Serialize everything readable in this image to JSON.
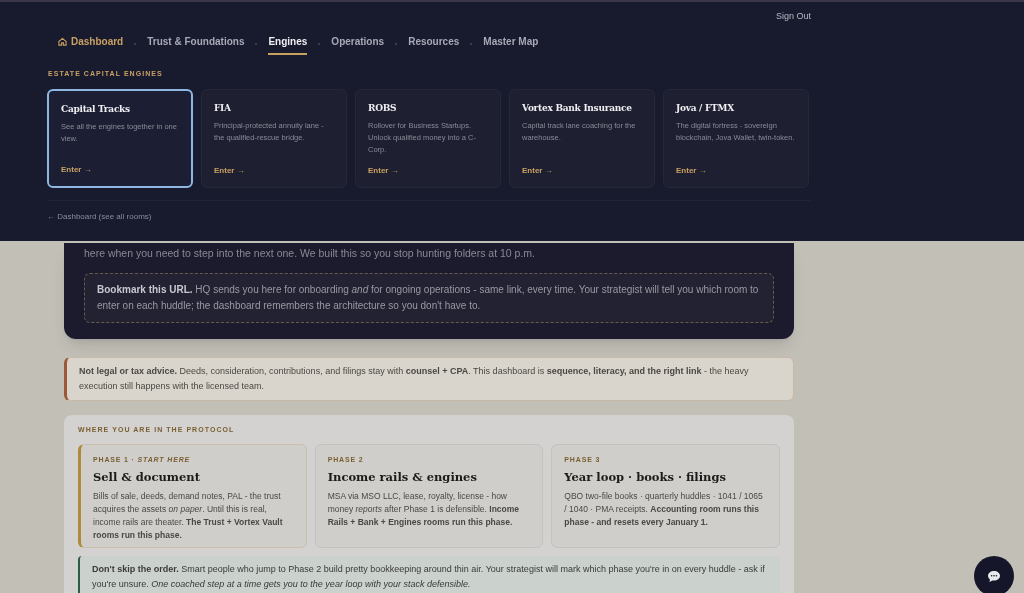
{
  "header": {
    "sign_out": "Sign Out",
    "nav": [
      {
        "label": "Dashboard",
        "kind": "home",
        "selected": false
      },
      {
        "label": "Trust & Foundations",
        "kind": "link",
        "selected": false
      },
      {
        "label": "Engines",
        "kind": "link",
        "selected": true
      },
      {
        "label": "Operations",
        "kind": "link",
        "selected": false
      },
      {
        "label": "Resources",
        "kind": "link",
        "selected": false
      },
      {
        "label": "Master Map",
        "kind": "link",
        "selected": false
      }
    ],
    "dropdown": {
      "heading": "ESTATE CAPITAL ENGINES",
      "engines": [
        {
          "title": "Capital Tracks",
          "description": "See all the engines together in one view.",
          "action": "Enter →",
          "selected": true
        },
        {
          "title": "FIA",
          "description": "Principal-protected annuity lane - the qualified-rescue bridge.",
          "action": "Enter →",
          "selected": false
        },
        {
          "title": "ROBS",
          "description": "Rollover for Business Startups. Unlock qualified money into a C-Corp.",
          "action": "Enter →",
          "selected": false
        },
        {
          "title": "Vortex Bank Insurance",
          "description": "Capital track lane coaching for the warehouse.",
          "action": "Enter →",
          "selected": false
        },
        {
          "title": "Jova / FTMX",
          "description": "The digital fortress - sovereign blockchain, Jova Wallet, twin-token.",
          "action": "Enter →",
          "selected": false
        }
      ],
      "back_link": "← Dashboard (see all rooms)"
    }
  },
  "hero": {
    "text": "here when you need to step into the next one. We built this so you stop hunting folders at 10 p.m.",
    "bookmark_note": "**Bookmark this URL.** HQ sends you here for onboarding *and* for ongoing operations - same link, every time. Your strategist will tell you which room to enter on each huddle; the dashboard remembers the architecture so you don't have to."
  },
  "disclaimer": "**Not legal or tax advice.** Deeds, consideration, contributions, and filings stay with **counsel + CPA**. This dashboard is **sequence, literacy, and the right link** - the heavy execution still happens with the licensed team.",
  "protocol": {
    "heading": "WHERE YOU ARE IN THE PROTOCOL",
    "phases": [
      {
        "label": "PHASE 1 · *START HERE*",
        "title": "Sell & document",
        "text": "Bills of sale, deeds, demand notes, PAL - the trust acquires the assets *on paper*. Until this is real, income rails are theater. **The Trust + Vortex Vault rooms run this phase.**",
        "selected": true
      },
      {
        "label": "PHASE 2",
        "title": "Income rails & engines",
        "text": "MSA via MSO LLC, lease, royalty, license - how money *reports* after Phase 1 is defensible. **Income Rails + Bank + Engines rooms run this phase.**",
        "selected": false
      },
      {
        "label": "PHASE 3",
        "title": "Year loop · books · filings",
        "text": "QBO two-file books · quarterly huddles · 1041 / 1065 / 1040 · PMA receipts. **Accounting room runs this phase - and resets every January 1.**",
        "selected": false
      }
    ],
    "order_note": "**Don't skip the order.** Smart people who jump to Phase 2 build pretty bookkeeping around thin air. Your strategist will mark which phase you're in on every huddle - ask if you're unsure. *One coached step at a time gets you to the year loop with your stack defensible.*"
  }
}
